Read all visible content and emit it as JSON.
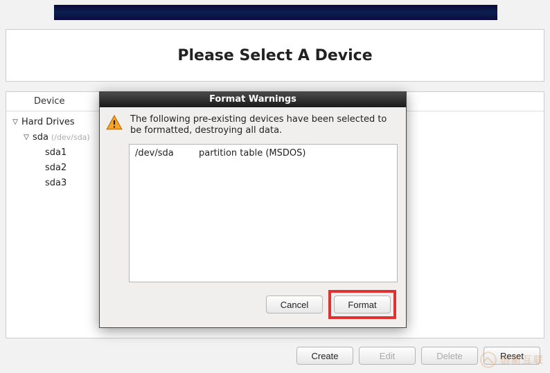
{
  "banner": "",
  "page_title": "Please Select A Device",
  "columns": {
    "device": "Device"
  },
  "tree": {
    "root_label": "Hard Drives",
    "disk": {
      "name": "sda",
      "path": "(/dev/sda)",
      "parts": [
        "sda1",
        "sda2",
        "sda3"
      ]
    }
  },
  "footer_buttons": {
    "create": "Create",
    "edit": "Edit",
    "delete": "Delete",
    "reset": "Reset"
  },
  "dialog": {
    "title": "Format Warnings",
    "message": "The following pre-existing devices have been selected to be formatted, destroying all data.",
    "rows": [
      {
        "device": "/dev/sda",
        "desc": "partition table (MSDOS)"
      }
    ],
    "buttons": {
      "cancel": "Cancel",
      "format": "Format"
    }
  },
  "watermark": "创新互联"
}
